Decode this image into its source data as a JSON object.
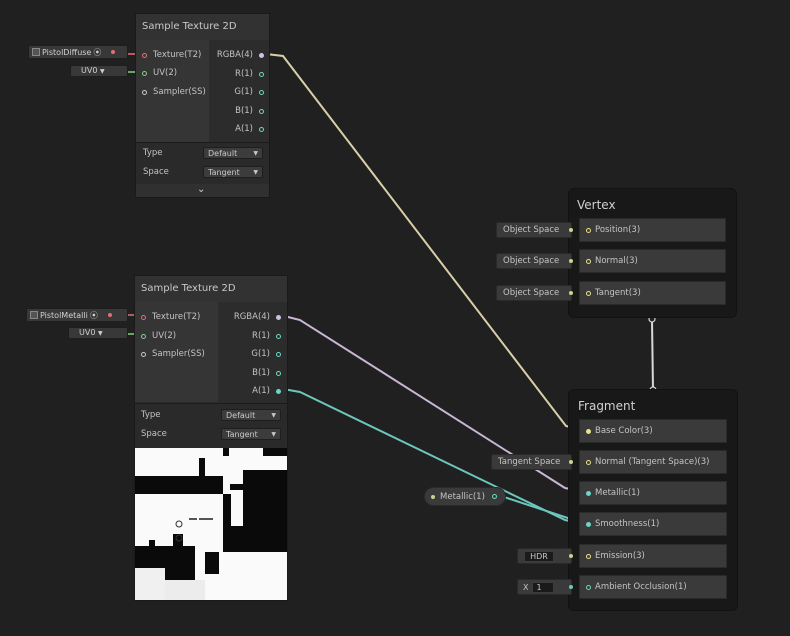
{
  "colors": {
    "canvas_bg": "#202020",
    "wire_rgba": "#d4c1d8",
    "wire_alpha": "#6cc6bb",
    "wire_vertex": "#d8d8d8",
    "texture_port": "#e07070",
    "uv_port": "#7fd37f",
    "vector_port": "#e9e38a"
  },
  "nodes": {
    "sample1": {
      "title": "Sample Texture 2D",
      "inputs": [
        "Texture(T2)",
        "UV(2)",
        "Sampler(SS)"
      ],
      "outputs": [
        "RGBA(4)",
        "R(1)",
        "G(1)",
        "B(1)",
        "A(1)"
      ],
      "type_label": "Type",
      "type_value": "Default",
      "space_label": "Space",
      "space_value": "Tangent",
      "texture_input": "PistolDiffuse",
      "uv_input": "UV0",
      "collapse_icon": "chevron-down-icon"
    },
    "sample2": {
      "title": "Sample Texture 2D",
      "inputs": [
        "Texture(T2)",
        "UV(2)",
        "Sampler(SS)"
      ],
      "outputs": [
        "RGBA(4)",
        "R(1)",
        "G(1)",
        "B(1)",
        "A(1)"
      ],
      "type_label": "Type",
      "type_value": "Default",
      "space_label": "Space",
      "space_value": "Tangent",
      "texture_input": "PistolMetalli",
      "uv_input": "UV0"
    }
  },
  "vertex": {
    "title": "Vertex",
    "blocks": [
      {
        "label": "Position(3)",
        "input": "Object Space"
      },
      {
        "label": "Normal(3)",
        "input": "Object Space"
      },
      {
        "label": "Tangent(3)",
        "input": "Object Space"
      }
    ]
  },
  "fragment": {
    "title": "Fragment",
    "blocks": [
      {
        "label": "Base Color(3)",
        "input": ""
      },
      {
        "label": "Normal (Tangent Space)(3)",
        "input": "Tangent Space"
      },
      {
        "label": "Metallic(1)",
        "input": ""
      },
      {
        "label": "Smoothness(1)",
        "input": ""
      },
      {
        "label": "Emission(3)",
        "input": "HDR"
      },
      {
        "label": "Ambient Occlusion(1)",
        "input_prefix": "X",
        "input": "1"
      }
    ]
  },
  "metallic_property": {
    "label": "Metallic(1)"
  }
}
